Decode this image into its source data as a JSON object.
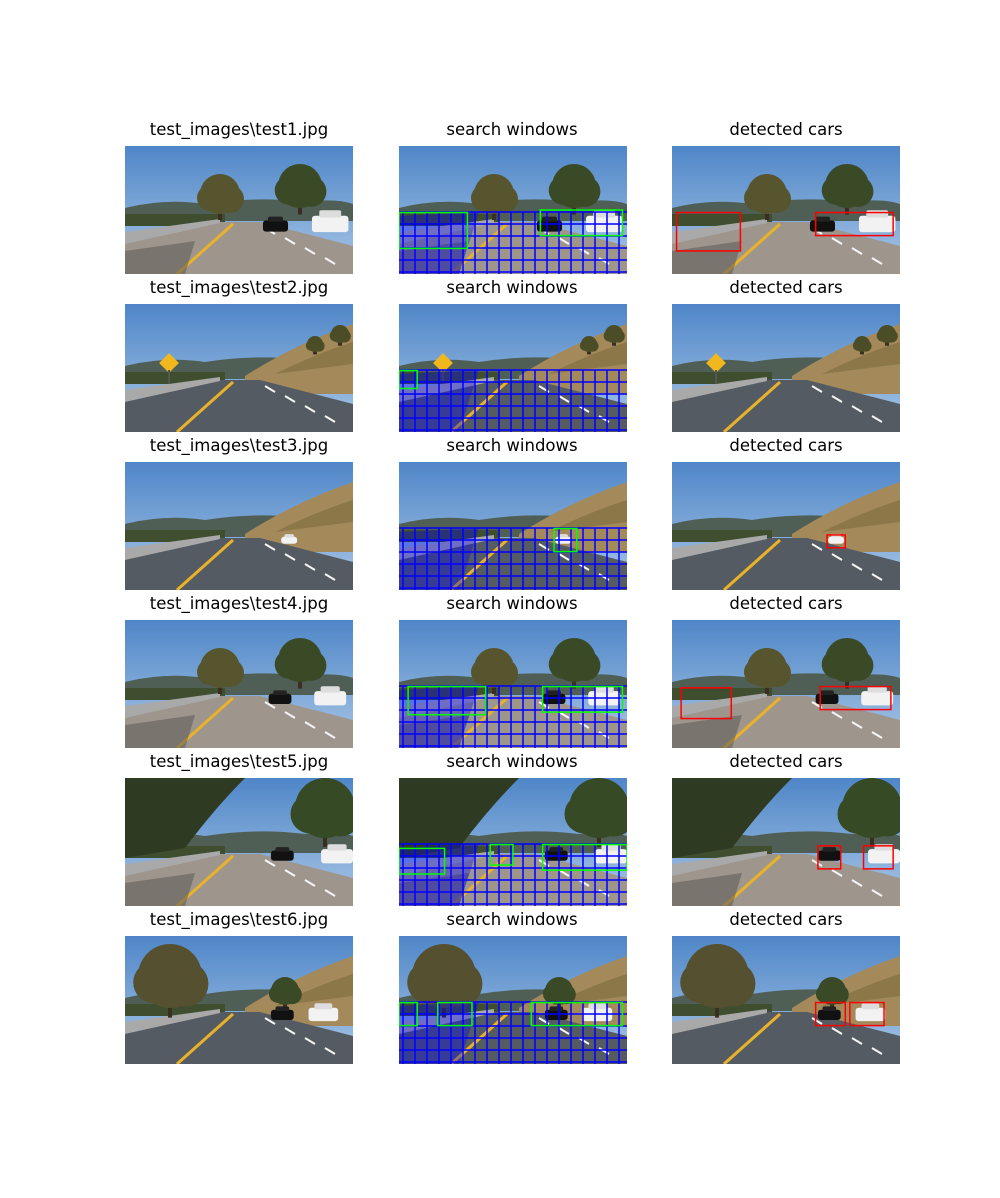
{
  "figure": {
    "rows": [
      {
        "titles": [
          "test_images\\test1.jpg",
          "search windows",
          "detected cars"
        ],
        "scene": {
          "trees": "oak",
          "signs": false,
          "hill": false,
          "cars": [
            [
              0.66,
              0.64,
              0.11,
              "#111"
            ],
            [
              0.9,
              0.63,
              0.16,
              "#f2f2f2"
            ]
          ],
          "shadow": true
        },
        "detections": [
          [
            0.02,
            0.52,
            0.28,
            0.3
          ],
          [
            0.63,
            0.52,
            0.34,
            0.18
          ]
        ],
        "search_hits": [
          [
            0.0,
            0.52,
            0.3,
            0.28
          ],
          [
            0.62,
            0.5,
            0.36,
            0.2
          ]
        ]
      },
      {
        "titles": [
          "test_images\\test2.jpg",
          "search windows",
          "detected cars"
        ],
        "scene": {
          "trees": "hill",
          "signs": true,
          "hill": true,
          "cars": [],
          "shadow": false
        },
        "detections": [],
        "search_hits": [
          [
            0.0,
            0.52,
            0.08,
            0.14
          ]
        ]
      },
      {
        "titles": [
          "test_images\\test3.jpg",
          "search windows",
          "detected cars"
        ],
        "scene": {
          "trees": "none",
          "signs": false,
          "hill": true,
          "cars": [
            [
              0.72,
              0.62,
              0.07,
              "#f2f2f2"
            ]
          ],
          "shadow": false
        },
        "detections": [
          [
            0.68,
            0.57,
            0.08,
            0.1
          ]
        ],
        "search_hits": [
          [
            0.68,
            0.52,
            0.1,
            0.18
          ]
        ]
      },
      {
        "titles": [
          "test_images\\test4.jpg",
          "search windows",
          "detected cars"
        ],
        "scene": {
          "trees": "oak",
          "signs": false,
          "hill": false,
          "cars": [
            [
              0.68,
              0.63,
              0.1,
              "#111"
            ],
            [
              0.9,
              0.63,
              0.14,
              "#f2f2f2"
            ]
          ],
          "shadow": true
        },
        "detections": [
          [
            0.04,
            0.53,
            0.22,
            0.24
          ],
          [
            0.65,
            0.52,
            0.31,
            0.18
          ]
        ],
        "search_hits": [
          [
            0.04,
            0.52,
            0.34,
            0.22
          ],
          [
            0.63,
            0.52,
            0.35,
            0.2
          ]
        ]
      },
      {
        "titles": [
          "test_images\\test5.jpg",
          "search windows",
          "detected cars"
        ],
        "scene": {
          "trees": "dense",
          "signs": false,
          "hill": false,
          "cars": [
            [
              0.69,
              0.62,
              0.1,
              "#111"
            ],
            [
              0.93,
              0.63,
              0.14,
              "#f2f2f2"
            ]
          ],
          "shadow": true
        },
        "detections": [
          [
            0.64,
            0.53,
            0.1,
            0.18
          ],
          [
            0.84,
            0.53,
            0.13,
            0.18
          ]
        ],
        "search_hits": [
          [
            0.0,
            0.55,
            0.2,
            0.2
          ],
          [
            0.4,
            0.52,
            0.1,
            0.16
          ],
          [
            0.63,
            0.52,
            0.37,
            0.2
          ]
        ]
      },
      {
        "titles": [
          "test_images\\test6.jpg",
          "search windows",
          "detected cars"
        ],
        "scene": {
          "trees": "big",
          "signs": false,
          "hill": true,
          "cars": [
            [
              0.69,
              0.63,
              0.1,
              "#111"
            ],
            [
              0.87,
              0.63,
              0.13,
              "#f2f2f2"
            ]
          ],
          "shadow": false
        },
        "detections": [
          [
            0.63,
            0.52,
            0.13,
            0.18
          ],
          [
            0.78,
            0.52,
            0.15,
            0.18
          ]
        ],
        "search_hits": [
          [
            0.0,
            0.52,
            0.08,
            0.18
          ],
          [
            0.17,
            0.52,
            0.15,
            0.18
          ],
          [
            0.58,
            0.52,
            0.4,
            0.18
          ]
        ]
      }
    ]
  },
  "colors": {
    "search_grid": "#0000ff",
    "search_hit": "#00ff00",
    "detection": "#ff0000"
  }
}
